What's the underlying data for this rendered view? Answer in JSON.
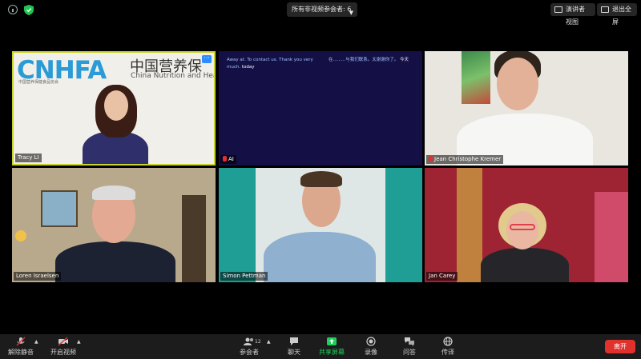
{
  "topbar": {
    "view_selector": "所有非视频参会者: 6",
    "speaker_view": "演讲者视图",
    "exit_fullscreen": "退出全屏"
  },
  "tiles": [
    {
      "name": "Tracy LI",
      "banner_logo": "CNHFA",
      "banner_sub": "中国营养保健食品协会",
      "banner_title": "中国营养保",
      "banner_en": "China Nutrition and Hea",
      "more": "···"
    },
    {
      "name": "AI",
      "caption_en_1": "Away at. To contact us. Thank you very",
      "caption_en_2": "much.",
      "caption_en_3": "today",
      "caption_zh_1": "在.........与我们联系。太谢谢你了。",
      "caption_zh_2": "今天"
    },
    {
      "name": "Jean Christophe Kremer"
    },
    {
      "name": "Loren Israelsen"
    },
    {
      "name": "Simon Pettman"
    },
    {
      "name": "Jan Carey"
    }
  ],
  "toolbar": {
    "unmute": "解除静音",
    "start_video": "开启视频",
    "participants": "参会者",
    "participants_count": "12",
    "chat": "聊天",
    "share_screen": "共享屏幕",
    "record": "录像",
    "qa": "问答",
    "interpretation": "传译",
    "leave": "离开"
  },
  "colors": {
    "active_border": "#c9d32a",
    "share_green": "#1fcf5a",
    "leave_red": "#e0312d",
    "muted_red": "#e0312d"
  }
}
